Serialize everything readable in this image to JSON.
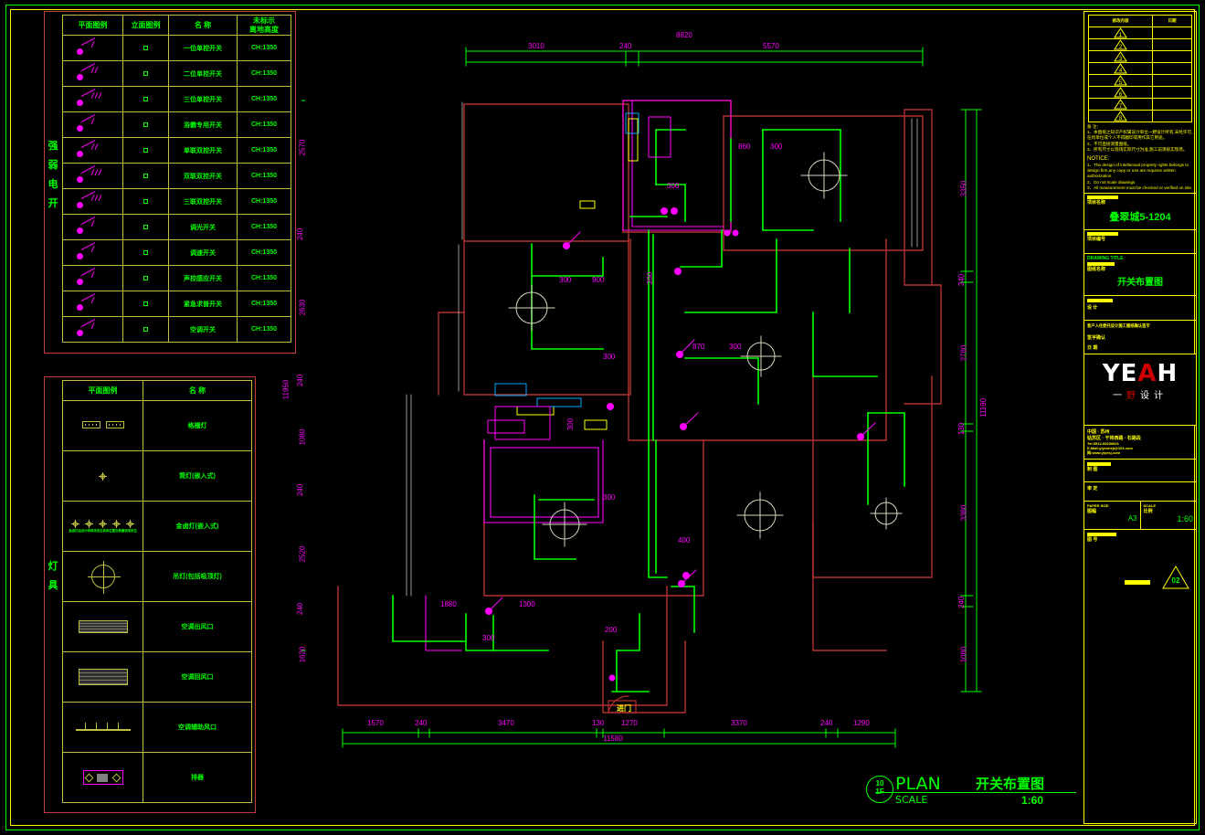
{
  "drawing": {
    "title_cn": "开关布置图",
    "title_en": "PLAN",
    "scale_label": "SCALE",
    "scale_value": "1:60",
    "floor_top": "10",
    "floor_bottom": "1F",
    "paper_size": "A3"
  },
  "legend_switch": {
    "side_caption": "强弱电开关",
    "headers": [
      "平面图例",
      "立面图例",
      "名    称",
      "未标示\n离地高度"
    ],
    "header_plan": "平面图例",
    "header_elev": "立面图例",
    "header_name": "名    称",
    "header_height_l1": "未标示",
    "header_height_l2": "离地高度",
    "rows": [
      {
        "name": "一位单控开关",
        "height": "CH:1350"
      },
      {
        "name": "二位单控开关",
        "height": "CH:1350"
      },
      {
        "name": "三位单控开关",
        "height": "CH:1350"
      },
      {
        "name": "浴霸专用开关",
        "height": "CH:1350"
      },
      {
        "name": "单联双控开关",
        "height": "CH:1350"
      },
      {
        "name": "双联双控开关",
        "height": "CH:1350"
      },
      {
        "name": "三联双控开关",
        "height": "CH:1350"
      },
      {
        "name": "调光开关",
        "height": "CH:1350"
      },
      {
        "name": "调速开关",
        "height": "CH:1350"
      },
      {
        "name": "声控感应开关",
        "height": "CH:1350"
      },
      {
        "name": "紧急求普开关",
        "height": "CH:1350"
      },
      {
        "name": "空调开关",
        "height": "CH:1350"
      }
    ]
  },
  "legend_lighting": {
    "side_caption": "灯具",
    "header_plan": "平面图例",
    "header_name": "名    称",
    "rows": [
      {
        "name": "格栅灯",
        "symbol": "strip-lamp-icon"
      },
      {
        "name": "筒灯(嵌入式)",
        "symbol": "downlight-icon"
      },
      {
        "name": "金卤灯(嵌入式)",
        "symbol": "metal-halide-icon",
        "note": "金卤灯由设计师现场定位具体位置及数量现场定位"
      },
      {
        "name": "吊灯(包括吸顶灯)",
        "symbol": "pendant-icon"
      },
      {
        "name": "空调出风口",
        "symbol": "ac-supply-grille-icon"
      },
      {
        "name": "空调回风口",
        "symbol": "ac-return-grille-icon"
      },
      {
        "name": "空调辅助风口",
        "symbol": "ac-linear-diffuser-icon"
      },
      {
        "name": "排器",
        "symbol": "exhaust-fan-icon"
      }
    ]
  },
  "dimensions": {
    "top_chain": [
      "3010",
      "240",
      "5570"
    ],
    "top_total": "8820",
    "bottom_chain": [
      "1570",
      "240",
      "3470",
      "130",
      "1270",
      "3370",
      "240",
      "1290"
    ],
    "bottom_total": "11580",
    "right_chain": [
      "3350",
      "240",
      "2780",
      "130",
      "3380",
      "240",
      "1080"
    ],
    "right_total": "11190",
    "left_chain": [
      "2570",
      "240",
      "2630",
      "240",
      "1080",
      "240",
      "2520",
      "240",
      "1620"
    ],
    "left_total": "11950",
    "interior": [
      "300",
      "900",
      "300",
      "860",
      "300",
      "870",
      "300",
      "1880",
      "1300",
      "300",
      "200",
      "400",
      "200",
      "300",
      "300",
      "300"
    ],
    "door_label": "进门"
  },
  "title_block": {
    "revision_header_left": "修改内容",
    "revision_header_right": "日期",
    "revision_rows": [
      "1",
      "2",
      "3",
      "4",
      "5",
      "6",
      "7",
      "8"
    ],
    "notes_cn_header": "备 注：",
    "notes_cn": [
      "1、本图纸之知识产权属设计单位一野设计所有,未经许可,任何单位或个人不得翻印或用作其它用途。",
      "2、不可直接测量图纸。",
      "3、所有尺寸以现场实际尺寸为准,施工前须核实现场。"
    ],
    "notes_en_header": "NOTICE:",
    "notes_en": [
      "1、The design of intellectual property rights belongs to design firm,any copy or use are requires written authorization.",
      "2、Do not scale drawings",
      "3、All measurement must be checked or verified on site."
    ],
    "project_name_label": "项目名称",
    "project_name_en": "PROJECT NAME",
    "project_name": "叠翠城5-1204",
    "project_no_label": "项目编号",
    "project_no_en": "PROJECT NO",
    "project_no": "",
    "drawing_title_label": "图纸名称",
    "drawing_title_en": "DRAWING TITLE",
    "drawing_title": "开关布置图",
    "designer_label": "设 计",
    "designer": "",
    "approver_label": "审 核",
    "approver": "",
    "consult_note": "客户入住委托设计施工图纸确认签字",
    "sign_label": "签字确认",
    "date_label": "日    期",
    "logo_main": "YEAH",
    "logo_sub": "一野设计",
    "company_line1": "中国 · 苏州",
    "company_line2": "姑苏区 · 干将西路 · 石路段",
    "company_line3": "Tel:0512-69230601",
    "company_line4": "E-Mail:yiyesheji@163.com",
    "company_line5": "网:www.yiyesj.com",
    "drawn_label": "制 图",
    "checked_label": "审 定",
    "paper_label": "图幅",
    "paper_en": "PAPER SIZE",
    "paper_value": "A3",
    "scale_label": "比例",
    "scale_en": "SCALE",
    "scale_value": "1:60",
    "sheet_label": "图 号",
    "sheet_en": "DRAWING NO",
    "sheet_value": "",
    "sheet_badge": "02"
  }
}
